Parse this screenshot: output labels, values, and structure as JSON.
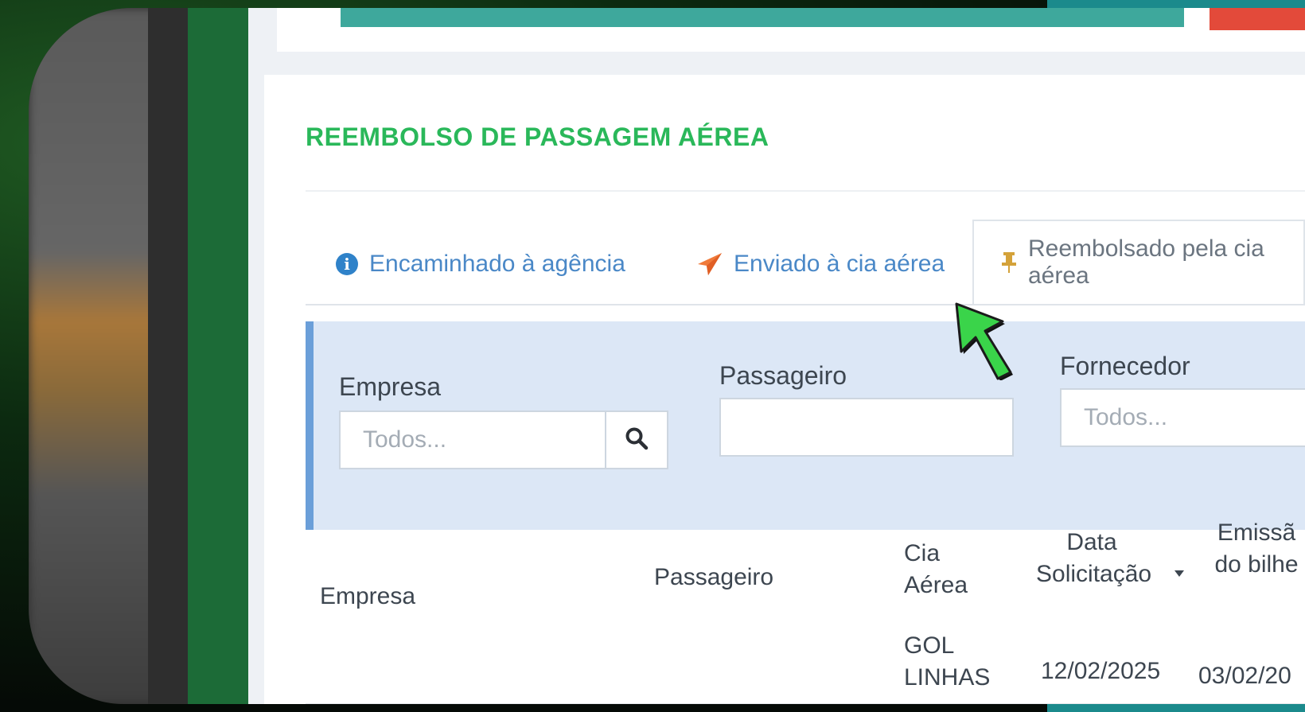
{
  "page": {
    "title": "REEMBOLSO DE PASSAGEM AÉREA"
  },
  "tabs": [
    {
      "label": "Encaminhado à agência",
      "icon": "info-circle-icon",
      "color": "#4a88c7"
    },
    {
      "label": "Enviado à cia aérea",
      "icon": "paper-plane-icon",
      "color": "#4a88c7"
    },
    {
      "label": "Reembolsado pela cia aérea",
      "icon": "pushpin-icon",
      "active": true
    }
  ],
  "filters": {
    "empresa": {
      "label": "Empresa",
      "placeholder": "Todos..."
    },
    "passageiro": {
      "label": "Passageiro",
      "value": ""
    },
    "fornecedor": {
      "label": "Fornecedor",
      "placeholder": "Todos..."
    }
  },
  "table": {
    "columns": [
      {
        "line1": "Empresa",
        "line2": ""
      },
      {
        "line1": "Passageiro",
        "line2": ""
      },
      {
        "line1": "Cia",
        "line2": "Aérea"
      },
      {
        "line1": "Data",
        "line2": "Solicitação"
      },
      {
        "line1": "Emissã",
        "line2": "do bilhe"
      }
    ],
    "rows": [
      {
        "cia_line1": "GOL",
        "cia_line2": "LINHAS",
        "data_solicitacao": "12/02/2025",
        "emissao": "03/02/20"
      }
    ]
  },
  "colors": {
    "title_green": "#2ab85a",
    "tab_blue": "#4a88c7",
    "plane_orange": "#f07a3a",
    "pin_gold": "#d4a23a",
    "panel_bg": "#dce7f6",
    "panel_border": "#6b9fd9"
  }
}
